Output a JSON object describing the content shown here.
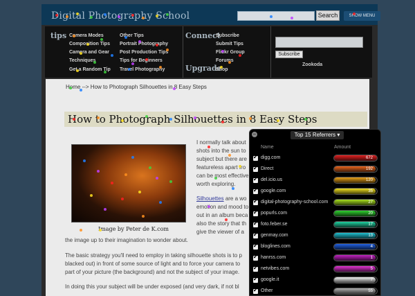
{
  "header": {
    "logo": "Digital Photography School",
    "search_button": "Search",
    "show_menu": "SHOW MENU"
  },
  "nav": {
    "tips_title": "tips",
    "tips_col1": [
      "Camera Modes",
      "Composition Tips",
      "Camera and Gear",
      "Techniques",
      "Get a Random Tip"
    ],
    "tips_col2": [
      "Other Tips",
      "Portrait Photography",
      "Post Production Tips",
      "Tips for Beginners",
      "Travel Photography"
    ],
    "connect_title": "Connect",
    "connect_links": [
      "Subscribe",
      "Submit Tips",
      "Flickr Group",
      "Forums"
    ],
    "upgrade_title": "Upgrade",
    "upgrade_link": "Shop",
    "subscribe_button": "Subscribe",
    "zookoda": "Zookoda"
  },
  "article": {
    "breadcrumb": "Home --> How to Photograph Silhouettes in 8 Easy Steps",
    "title": "How to Photograph Silhouettes in 8 Easy Steps",
    "caption": "Image by Peter de K.com",
    "intro_lines": [
      "I normally talk about",
      "shots into the sun to",
      "subject but there are",
      "featureless apart fro",
      "can be most effective",
      "worth exploring."
    ],
    "silhouettes_link": "Silhouettes",
    "sil_line1_rest": " are a wo",
    "sil_lines": [
      "emotion and mood to",
      "out in an album beca",
      "also the story that th",
      "give the viewer of a"
    ],
    "imagination_line": "the image up to their imagination to wonder about.",
    "strategy_lines": [
      "The basic strategy you'll need to employ in taking silhouette shots is to p",
      "blacked out) in front of some source of light and to force your camera to",
      "part of your picture (the background) and not the subject of your image."
    ],
    "exposure_line": "In doing this your subject will be under exposed (and very dark, if not bl"
  },
  "referrers": {
    "title": "Top 15 Referrers",
    "col_name": "Name",
    "col_amount": "Amount",
    "rows": [
      {
        "name": "digg.com",
        "amount": "672",
        "fraction": 1.0,
        "color": "#e02020"
      },
      {
        "name": "Direct",
        "amount": "192",
        "fraction": 0.96,
        "color": "#e8641c"
      },
      {
        "name": "del.icio.us",
        "amount": "120",
        "fraction": 0.96,
        "color": "#e8a018"
      },
      {
        "name": "google.com",
        "amount": "35",
        "fraction": 0.96,
        "color": "#f0e020"
      },
      {
        "name": "digital-photography-school.com",
        "amount": "27",
        "fraction": 0.96,
        "color": "#a8e020"
      },
      {
        "name": "popurls.com",
        "amount": "20",
        "fraction": 0.96,
        "color": "#30d030"
      },
      {
        "name": "foto.feber.se",
        "amount": "17",
        "fraction": 0.96,
        "color": "#20d0a0"
      },
      {
        "name": "genmay.com",
        "amount": "13",
        "fraction": 0.96,
        "color": "#20c0d0"
      },
      {
        "name": "bloglines.com",
        "amount": "4",
        "fraction": 0.96,
        "color": "#2060e0"
      },
      {
        "name": "hanrss.com",
        "amount": "1",
        "fraction": 0.96,
        "color": "#c020c0"
      },
      {
        "name": "netvibes.com",
        "amount": "5",
        "fraction": 0.96,
        "color": "#e030d0"
      },
      {
        "name": "google.it",
        "amount": "7",
        "fraction": 0.96,
        "color": "#f0f0f0"
      },
      {
        "name": "Other",
        "amount": "55",
        "fraction": 0.96,
        "color": "#b0b0b0"
      }
    ]
  },
  "heatmap_colors": [
    "#ff2020",
    "#ff9020",
    "#ffe020",
    "#40d040",
    "#2080ff",
    "#c040ff"
  ]
}
